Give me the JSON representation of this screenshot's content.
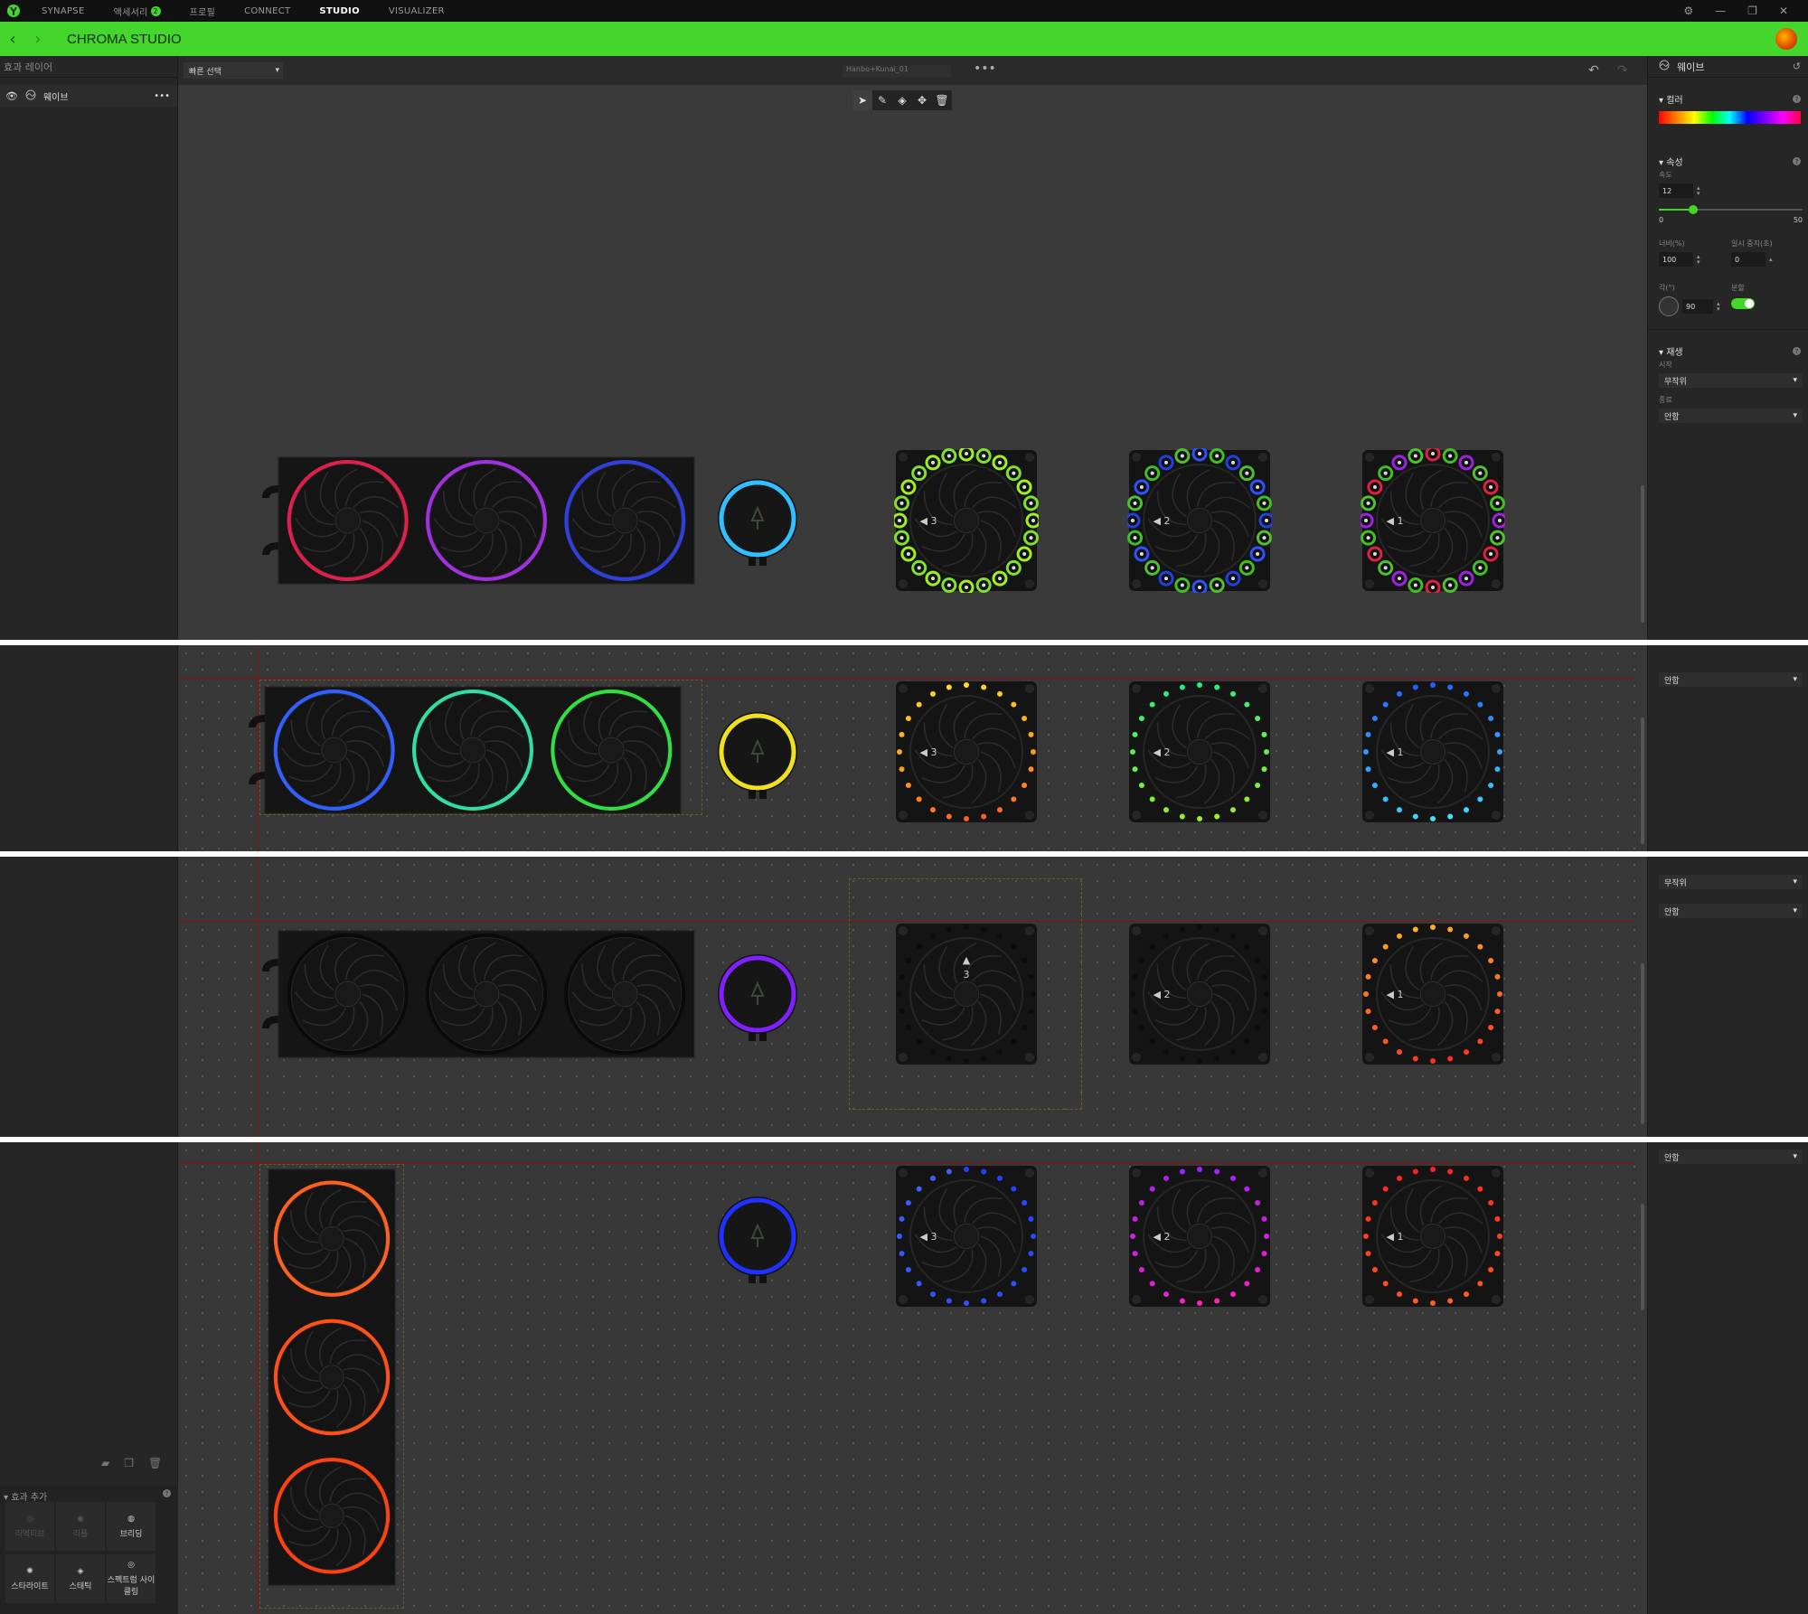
{
  "titlebar": {
    "tabs": [
      {
        "label": "SYNAPSE",
        "active": false
      },
      {
        "label": "액세서리",
        "active": false,
        "badge": "2"
      },
      {
        "label": "프로필",
        "active": false
      },
      {
        "label": "CONNECT",
        "active": false
      },
      {
        "label": "STUDIO",
        "active": true
      },
      {
        "label": "VISUALIZER",
        "active": false
      }
    ],
    "controls": {
      "settings": "⚙",
      "minimize": "—",
      "restore": "❐",
      "close": "✕"
    }
  },
  "header": {
    "title": "CHROMA STUDIO",
    "back": "‹",
    "forward": "›"
  },
  "left_panel": {
    "heading": "효과 레이어",
    "layer": {
      "name": "웨이브",
      "menu": "•••"
    },
    "add_effects": {
      "heading": "효과 추가",
      "effects": [
        "리액티브",
        "리플",
        "브리딩",
        "스타라이트",
        "스태틱",
        "스펙트럼 사이클링"
      ]
    }
  },
  "canvas": {
    "quick_select": "빠른 선택",
    "file_name": "Hanbo+Kunai_01",
    "file_menu": "•••",
    "fan_labels": [
      "3",
      "2",
      "1"
    ]
  },
  "right_panel": {
    "effect_title": "웨이브",
    "color_heading": "컬러",
    "props_heading": "속성",
    "speed_label": "속도",
    "speed_value": "12",
    "speed_min": "0",
    "speed_max": "50",
    "speed_fraction": 0.24,
    "width_label": "너비(%)",
    "width_value": "100",
    "pause_label": "일시 중지(초)",
    "pause_value": "0",
    "angle_label": "각(°)",
    "angle_value": "90",
    "split_label": "분할",
    "split_on": true,
    "playback_heading": "재생",
    "start_label": "시작",
    "start_value": "무작위",
    "end_label": "종료",
    "end_value": "안함"
  },
  "colors": {
    "accent": "#44d62c",
    "guide": "#8b0f0f"
  }
}
